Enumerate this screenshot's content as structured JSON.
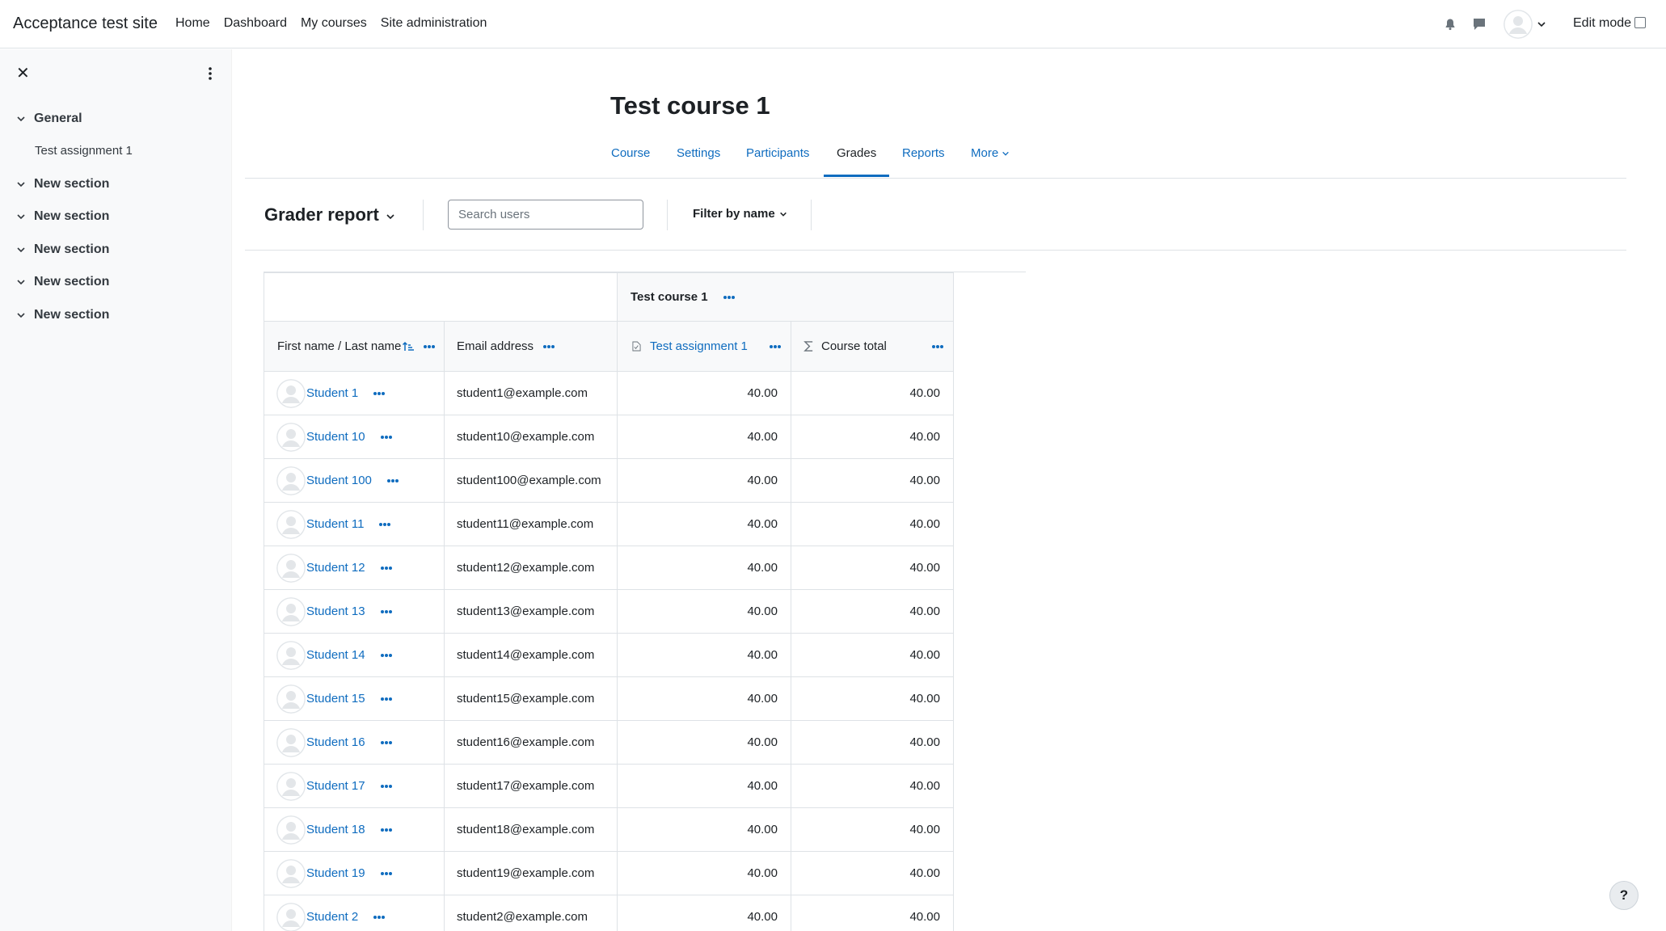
{
  "navbar": {
    "site_name": "Acceptance test site",
    "links": [
      "Home",
      "Dashboard",
      "My courses",
      "Site administration"
    ],
    "edit_mode_label": "Edit mode"
  },
  "drawer": {
    "items": [
      {
        "label": "General",
        "type": "section"
      },
      {
        "label": "Test assignment 1",
        "type": "activity"
      },
      {
        "label": "New section",
        "type": "section"
      },
      {
        "label": "New section",
        "type": "section"
      },
      {
        "label": "New section",
        "type": "section"
      },
      {
        "label": "New section",
        "type": "section"
      },
      {
        "label": "New section",
        "type": "section"
      }
    ]
  },
  "course": {
    "title": "Test course 1",
    "tabs": [
      "Course",
      "Settings",
      "Participants",
      "Grades",
      "Reports",
      "More"
    ],
    "active_tab": "Grades"
  },
  "toolbar": {
    "report_title": "Grader report",
    "search_placeholder": "Search users",
    "filter_label": "Filter by name"
  },
  "table": {
    "category_header": "Test course 1",
    "headers": {
      "name": "First name / Last name",
      "email": "Email address",
      "assignment": "Test assignment 1",
      "total": "Course total"
    },
    "rows": [
      {
        "name": "Student 1",
        "email": "student1@example.com",
        "assignment": "40.00",
        "total": "40.00"
      },
      {
        "name": "Student 10",
        "email": "student10@example.com",
        "assignment": "40.00",
        "total": "40.00"
      },
      {
        "name": "Student 100",
        "email": "student100@example.com",
        "assignment": "40.00",
        "total": "40.00"
      },
      {
        "name": "Student 11",
        "email": "student11@example.com",
        "assignment": "40.00",
        "total": "40.00"
      },
      {
        "name": "Student 12",
        "email": "student12@example.com",
        "assignment": "40.00",
        "total": "40.00"
      },
      {
        "name": "Student 13",
        "email": "student13@example.com",
        "assignment": "40.00",
        "total": "40.00"
      },
      {
        "name": "Student 14",
        "email": "student14@example.com",
        "assignment": "40.00",
        "total": "40.00"
      },
      {
        "name": "Student 15",
        "email": "student15@example.com",
        "assignment": "40.00",
        "total": "40.00"
      },
      {
        "name": "Student 16",
        "email": "student16@example.com",
        "assignment": "40.00",
        "total": "40.00"
      },
      {
        "name": "Student 17",
        "email": "student17@example.com",
        "assignment": "40.00",
        "total": "40.00"
      },
      {
        "name": "Student 18",
        "email": "student18@example.com",
        "assignment": "40.00",
        "total": "40.00"
      },
      {
        "name": "Student 19",
        "email": "student19@example.com",
        "assignment": "40.00",
        "total": "40.00"
      },
      {
        "name": "Student 2",
        "email": "student2@example.com",
        "assignment": "40.00",
        "total": "40.00"
      }
    ]
  },
  "help_button_label": "?",
  "colors": {
    "link": "#0f6cbf",
    "drawer_bg": "#f8f9fa",
    "border": "#dee2e6",
    "text": "#1d2125"
  },
  "icons": [
    "bell-icon",
    "chat-icon",
    "user-avatar-icon",
    "chevron-down-icon",
    "close-icon",
    "kebab-icon",
    "sort-icon",
    "more-dots-icon",
    "assignment-icon",
    "sigma-icon",
    "help-icon"
  ]
}
